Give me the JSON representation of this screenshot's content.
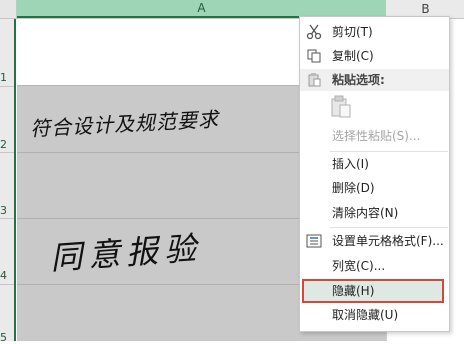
{
  "sheet": {
    "columns": [
      "A",
      "B"
    ],
    "rows": [
      "1",
      "2",
      "3",
      "4",
      "5"
    ],
    "cell_a2": "符合设计及规范要求",
    "cell_a4": "同意报验"
  },
  "menu": {
    "items": [
      {
        "label": "剪切(T)",
        "icon": "scissors-icon",
        "enabled": true
      },
      {
        "label": "复制(C)",
        "icon": "copy-icon",
        "enabled": true
      },
      {
        "label": "粘贴选项:",
        "icon": "paste-icon",
        "section": true
      },
      {
        "label": "",
        "icon": "paste-clipboard-icon",
        "enabled": false
      },
      {
        "label": "选择性粘贴(S)...",
        "icon": "",
        "enabled": false
      },
      {
        "label": "插入(I)",
        "icon": "",
        "enabled": true
      },
      {
        "label": "删除(D)",
        "icon": "",
        "enabled": true
      },
      {
        "label": "清除内容(N)",
        "icon": "",
        "enabled": true
      },
      {
        "label": "设置单元格格式(F)...",
        "icon": "format-cells-icon",
        "enabled": true
      },
      {
        "label": "列宽(C)...",
        "icon": "",
        "enabled": true
      },
      {
        "label": "隐藏(H)",
        "icon": "",
        "enabled": true,
        "highlighted": true
      },
      {
        "label": "取消隐藏(U)",
        "icon": "",
        "enabled": true
      }
    ]
  },
  "colors": {
    "selected_header": "#9fd5b7",
    "accent_green": "#217346",
    "highlight_border": "#d6473a"
  }
}
